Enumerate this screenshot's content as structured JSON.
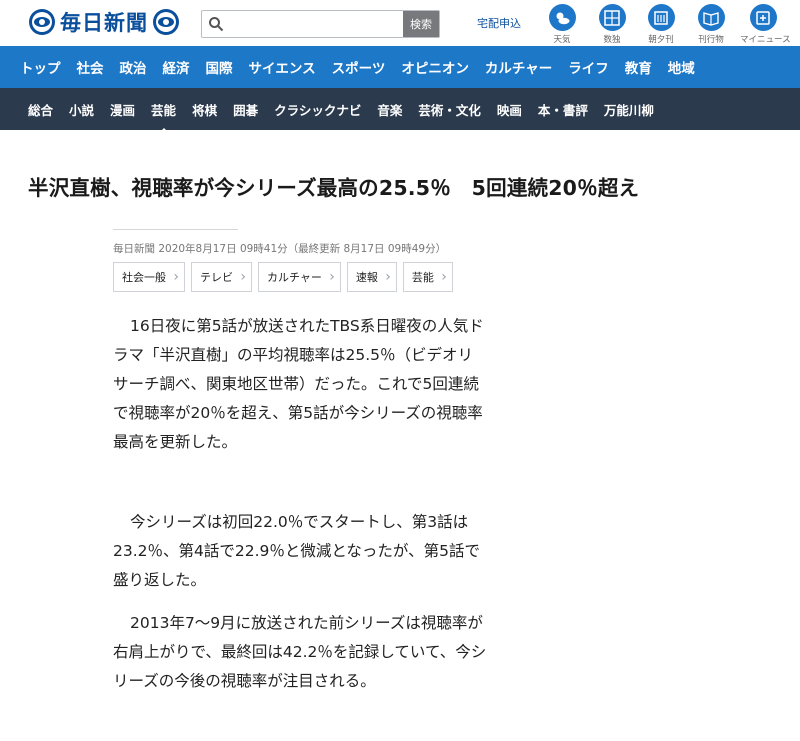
{
  "header": {
    "logo_text": "毎日新聞",
    "search": {
      "value": "",
      "placeholder": "",
      "button_label": "検索"
    },
    "delivery_label": "宅配申込",
    "icons": [
      {
        "name": "weather-icon",
        "label": "天気"
      },
      {
        "name": "sudoku-icon",
        "label": "数独"
      },
      {
        "name": "newspaper-icon",
        "label": "朝夕刊"
      },
      {
        "name": "publication-icon",
        "label": "刊行物"
      },
      {
        "name": "my-news-icon",
        "label": "マイニュース"
      }
    ]
  },
  "nav_primary": [
    "トップ",
    "社会",
    "政治",
    "経済",
    "国際",
    "サイエンス",
    "スポーツ",
    "オピニオン",
    "カルチャー",
    "ライフ",
    "教育",
    "地域"
  ],
  "nav_secondary": [
    "総合",
    "小説",
    "漫画",
    "芸能",
    "将棋",
    "囲碁",
    "クラシックナビ",
    "音楽",
    "芸術・文化",
    "映画",
    "本・書評",
    "万能川柳"
  ],
  "article": {
    "headline": "半沢直樹、視聴率が今シリーズ最高の25.5％　5回連続20％超え",
    "dateline": "毎日新聞 2020年8月17日 09時41分（最終更新 8月17日 09時49分）",
    "tags": [
      "社会一般",
      "テレビ",
      "カルチャー",
      "速報",
      "芸能"
    ],
    "paragraphs": [
      "16日夜に第5話が放送されたTBS系日曜夜の人気ドラマ「半沢直樹」の平均視聴率は25.5％（ビデオリサーチ調べ、関東地区世帯）だった。これで5回連続で視聴率が20％を超え、第5話が今シリーズの視聴率最高を更新した。",
      "今シリーズは初回22.0％でスタートし、第3話は23.2％、第4話で22.9％と微減となったが、第5話で盛り返した。",
      "2013年7～9月に放送された前シリーズは視聴率が右肩上がりで、最終回は42.2％を記録していて、今シリーズの今後の視聴率が注目される。"
    ]
  }
}
